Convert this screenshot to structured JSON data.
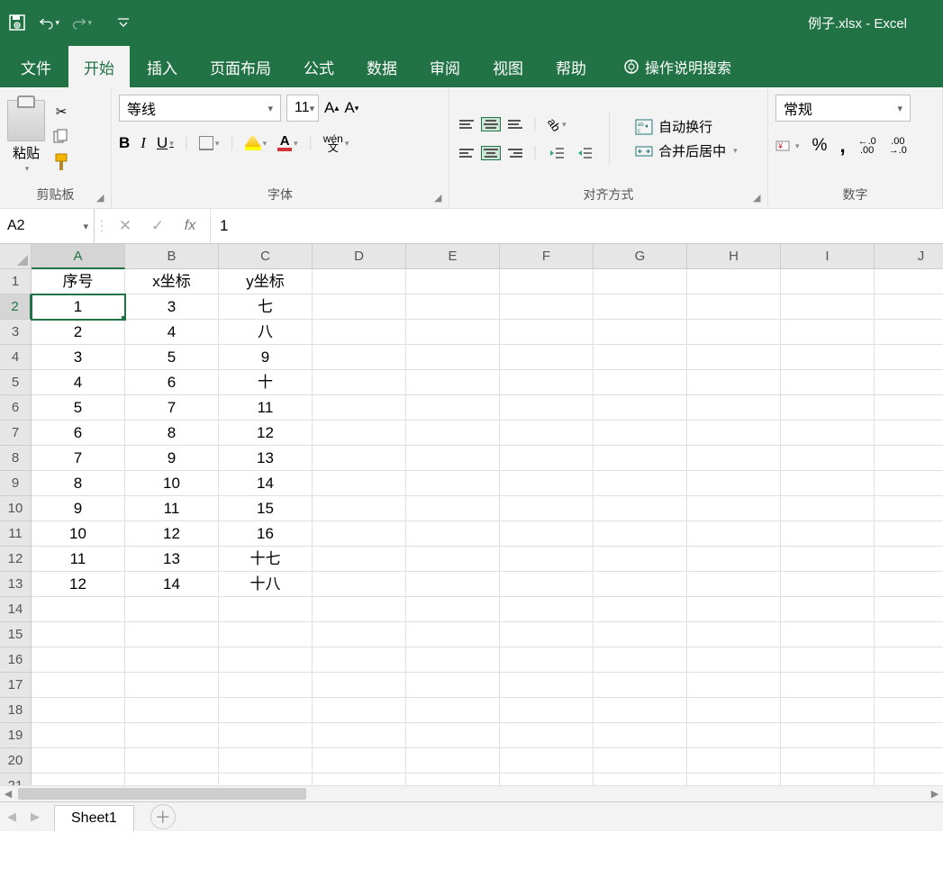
{
  "title_bar": {
    "doc_title": "例子.xlsx  -  Excel"
  },
  "tabs": {
    "file": "文件",
    "home": "开始",
    "insert": "插入",
    "layout": "页面布局",
    "formulas": "公式",
    "data": "数据",
    "review": "审阅",
    "view": "视图",
    "help": "帮助",
    "tellme": "操作说明搜索"
  },
  "ribbon": {
    "clipboard": {
      "paste": "粘贴",
      "group_label": "剪贴板"
    },
    "font": {
      "name": "等线",
      "size": "11",
      "wen_top": "wén",
      "wen_bot": "文",
      "group_label": "字体"
    },
    "alignment": {
      "wrap": "自动换行",
      "merge": "合并后居中",
      "group_label": "对齐方式"
    },
    "number": {
      "format": "常规",
      "percent": "%",
      "comma": ",",
      "inc_dec_left": "←.0",
      "inc_dec_left2": ".00",
      "inc_dec_right": ".00",
      "inc_dec_right2": "→.0",
      "group_label": "数字"
    }
  },
  "formula_bar": {
    "name_box": "A2",
    "value": "1"
  },
  "grid": {
    "columns": [
      "A",
      "B",
      "C",
      "D",
      "E",
      "F",
      "G",
      "H",
      "I",
      "J"
    ],
    "row_count": 22,
    "active_col": 0,
    "active_row": 1,
    "headers": [
      "序号",
      "x坐标",
      "y坐标"
    ],
    "rows": [
      [
        "1",
        "3",
        "七"
      ],
      [
        "2",
        "4",
        "八"
      ],
      [
        "3",
        "5",
        "9"
      ],
      [
        "4",
        "6",
        "十"
      ],
      [
        "5",
        "7",
        "11"
      ],
      [
        "6",
        "8",
        "12"
      ],
      [
        "7",
        "9",
        "13"
      ],
      [
        "8",
        "10",
        "14"
      ],
      [
        "9",
        "11",
        "15"
      ],
      [
        "10",
        "12",
        "16"
      ],
      [
        "11",
        "13",
        "十七"
      ],
      [
        "12",
        "14",
        "十八"
      ]
    ]
  },
  "sheet_bar": {
    "sheet1": "Sheet1"
  }
}
